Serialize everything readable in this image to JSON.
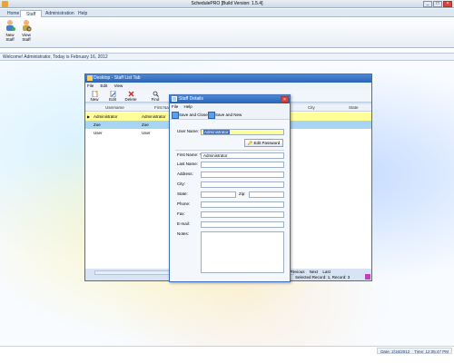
{
  "app": {
    "title": "SchedulePRO [Build Version: 1.5.4]"
  },
  "menu_tabs": [
    "Home",
    "Staff",
    "Administration",
    "Help"
  ],
  "ribbon": {
    "buttons": [
      {
        "label_line1": "New",
        "label_line2": "Staff"
      },
      {
        "label_line1": "View",
        "label_line2": "Staff"
      }
    ]
  },
  "welcome": "Welcome! Administrator, Today is February 16, 2012",
  "status": {
    "date": "Date: 2/16/2012",
    "time": "Time: 12:05:47 PM"
  },
  "staff_window": {
    "title": "Desktop - Staff List Tab",
    "menu": [
      "File",
      "Edit",
      "View"
    ],
    "toolbar": [
      "New",
      "Edit",
      "Delete",
      "Find"
    ],
    "columns": [
      "Username",
      "First Name",
      "City",
      "State"
    ],
    "rows": [
      {
        "username": "Administrator",
        "first_name": "Administrator"
      },
      {
        "username": "Zoe",
        "first_name": "Zoe"
      },
      {
        "username": "User",
        "first_name": "User"
      }
    ],
    "nav": [
      "Previous",
      "Next",
      "Last"
    ],
    "record_info": "Selected Record: 1, Record: 3"
  },
  "details": {
    "title": "Staff Details",
    "menu": [
      "File",
      "Help"
    ],
    "save_close": "Save and Close",
    "save_new": "Save and New",
    "edit_password": "Edit Password",
    "labels": {
      "username": "User Name:",
      "first_name": "First Name:",
      "last_name": "Last Name:",
      "address": "Address:",
      "city": "City:",
      "state": "State:",
      "zip": "Zip:",
      "phone": "Phone:",
      "fax": "Fax:",
      "email": "E-mail:",
      "notes": "Notes:"
    },
    "values": {
      "username": "Administrator",
      "first_name": "Administrator"
    }
  },
  "colors": {
    "title_blue": "#2a62b4",
    "selected_row": "#ffff99",
    "alt_row": "#a9d5f5"
  }
}
